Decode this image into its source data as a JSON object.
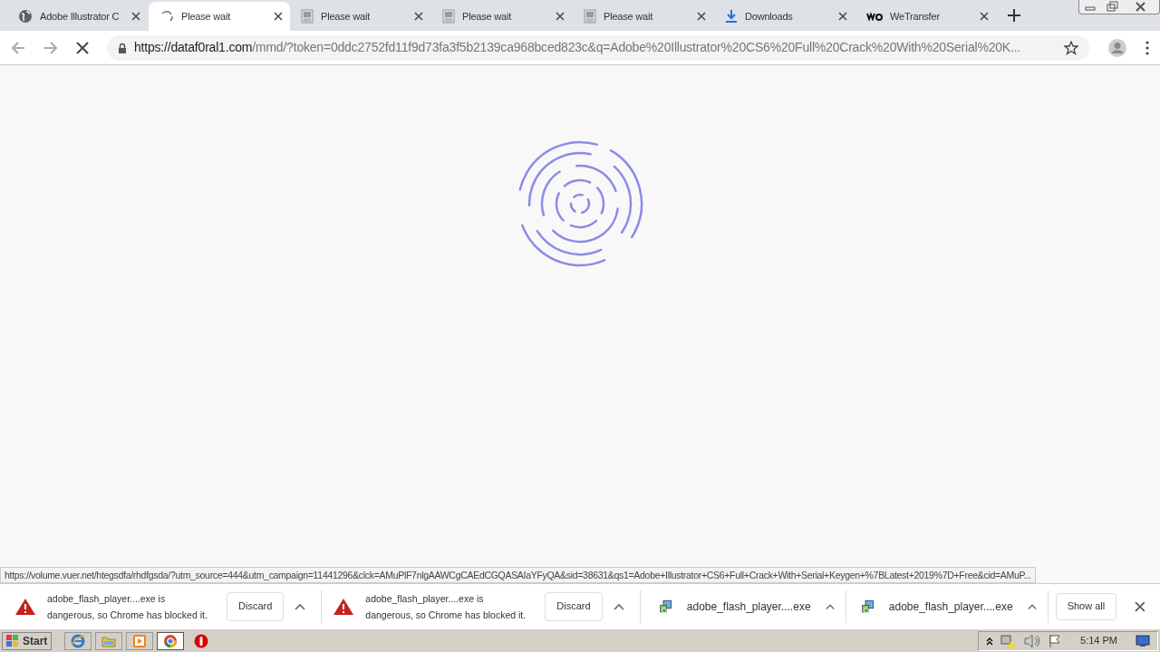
{
  "tabs": [
    {
      "kind": "globe",
      "title": "Adobe Illustrator C",
      "selected": false
    },
    {
      "kind": "loading",
      "title": "Please wait",
      "selected": true
    },
    {
      "kind": "page",
      "title": "Please wait",
      "selected": false
    },
    {
      "kind": "page",
      "title": "Please wait",
      "selected": false
    },
    {
      "kind": "page",
      "title": "Please wait",
      "selected": false
    },
    {
      "kind": "download",
      "title": "Downloads",
      "selected": false
    },
    {
      "kind": "wetransfer",
      "title": "WeTransfer",
      "selected": false
    }
  ],
  "address_bar": {
    "host": "https://dataf0ral1.com",
    "path": "/mmd/?token=0ddc2752fd11f9d73fa3f5b2139ca968bced823c&q=Adobe%20Illustrator%20CS6%20Full%20Crack%20With%20Serial%20K..."
  },
  "status_url": "https://volume.vuer.net/htegsdfa/rhdfgsda/?utm_source=444&utm_campaign=11441296&clck=AMuPlF7nlgAAWCgCAEdCGQASAIaYFyQA&sid=38631&qs1=Adobe+Illustrator+CS6+Full+Crack+With+Serial+Keygen+%7BLatest+2019%7D+Free&cid=AMuP...",
  "downloads": [
    {
      "kind": "blocked",
      "line1": "adobe_flash_player....exe is",
      "line2": "dangerous, so Chrome has blocked it.",
      "button": "Discard"
    },
    {
      "kind": "blocked",
      "line1": "adobe_flash_player....exe is",
      "line2": "dangerous, so Chrome has blocked it.",
      "button": "Discard"
    },
    {
      "kind": "file",
      "name": "adobe_flash_player....exe"
    },
    {
      "kind": "file",
      "name": "adobe_flash_player....exe"
    }
  ],
  "show_all": "Show all",
  "taskbar": {
    "start": "Start",
    "apps": [
      {
        "kind": "ie",
        "selected": false
      },
      {
        "kind": "folder",
        "selected": false
      },
      {
        "kind": "media",
        "selected": false
      },
      {
        "kind": "chrome",
        "selected": true
      },
      {
        "kind": "stop",
        "selected": false
      }
    ],
    "clock": "5:14 PM"
  }
}
